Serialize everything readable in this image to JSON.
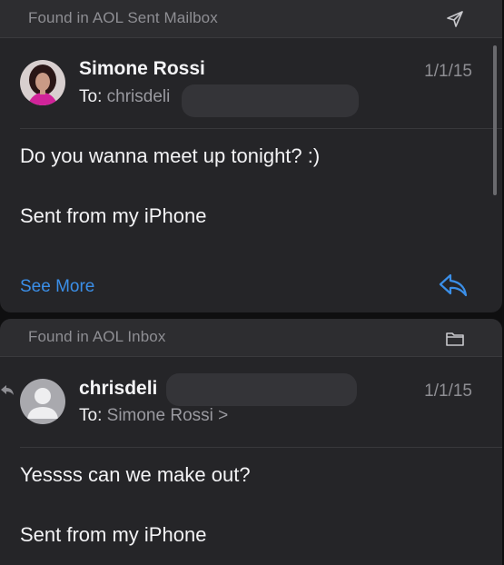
{
  "results": [
    {
      "found_in": "Found in AOL Sent Mailbox",
      "header_icon": "paper-plane-icon",
      "sender": "Simone Rossi",
      "to_label": "To:",
      "to_value": "chrisdeli",
      "date": "1/1/15",
      "body": [
        "Do you wanna meet up tonight? :)",
        "Sent from my iPhone"
      ],
      "action_label": "See More",
      "action_icon": "reply-icon"
    },
    {
      "found_in": "Found in AOL Inbox",
      "header_icon": "folder-icon",
      "sender": "chrisdeli",
      "to_label": "To:",
      "to_value": "Simone Rossi",
      "to_chevron": ">",
      "date": "1/1/15",
      "body": [
        "Yessss can we make out?",
        "Sent from my iPhone"
      ],
      "status_icon": "replied-arrow-icon"
    }
  ],
  "colors": {
    "background": "#0f0f10",
    "card": "#252528",
    "header": "#2d2d30",
    "link": "#3b8fe8",
    "secondary_text": "#8e8e93"
  }
}
